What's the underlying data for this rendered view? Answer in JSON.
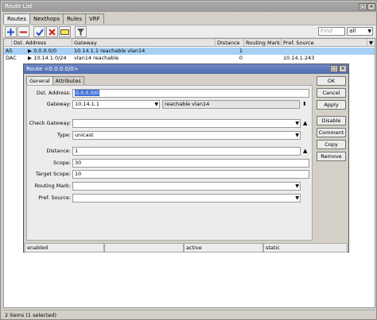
{
  "window": {
    "title": "Route List"
  },
  "tabs": [
    {
      "label": "Routes"
    },
    {
      "label": "Nexthops"
    },
    {
      "label": "Rules"
    },
    {
      "label": "VRF"
    }
  ],
  "toolbar": {
    "find_placeholder": "Find",
    "filter_value": "all"
  },
  "table": {
    "columns": [
      "",
      "Dst. Address",
      "Gateway",
      "Distance",
      "Routing Mark",
      "Pref. Source"
    ],
    "rows": [
      {
        "flags": "AS",
        "dst": "0.0.0.0/0",
        "gateway": "10.14.1.1 reachable vlan14",
        "distance": "1",
        "mark": "",
        "pref": ""
      },
      {
        "flags": "DAC",
        "dst": "10.14.1.0/24",
        "gateway": "vlan14 reachable",
        "distance": "0",
        "mark": "",
        "pref": "10.14.1.243"
      }
    ]
  },
  "status": {
    "text": "2 items (1 selected)"
  },
  "dialog": {
    "title": "Route <0.0.0.0/0>",
    "tabs": [
      "General",
      "Attributes"
    ],
    "fields": {
      "dst_label": "Dst. Address:",
      "dst_value": "0.0.0.0/0",
      "gateway_label": "Gateway:",
      "gateway_value": "10.14.1.1",
      "gateway_state": "reachable vlan14",
      "check_label": "Check Gateway:",
      "check_value": "",
      "type_label": "Type:",
      "type_value": "unicast",
      "distance_label": "Distance:",
      "distance_value": "1",
      "scope_label": "Scope:",
      "scope_value": "30",
      "target_label": "Target Scope:",
      "target_value": "10",
      "mark_label": "Routing Mark:",
      "mark_value": "",
      "pref_label": "Pref. Source:",
      "pref_value": ""
    },
    "buttons": [
      "OK",
      "Cancel",
      "Apply",
      "Disable",
      "Comment",
      "Copy",
      "Remove"
    ],
    "status": [
      "enabled",
      "",
      "active",
      "static"
    ]
  },
  "colors": {
    "selection": "#a8d0f4",
    "dialog_title": "#4e6db0"
  }
}
